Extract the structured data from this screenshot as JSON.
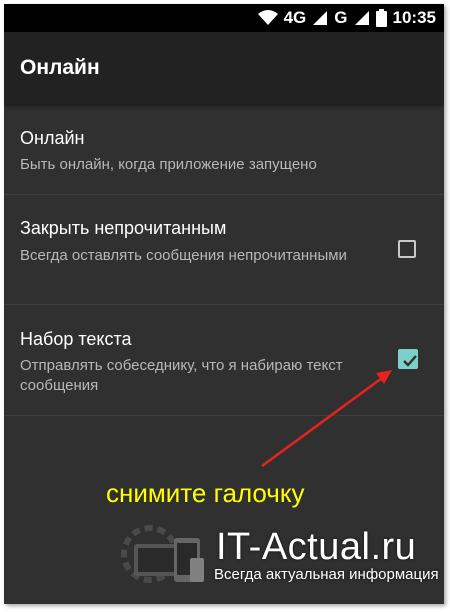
{
  "status_bar": {
    "network": "4G",
    "network2": "G",
    "time": "10:35",
    "icons": [
      "wifi-icon",
      "signal-icon",
      "signal-icon-2",
      "battery-icon"
    ]
  },
  "app_bar": {
    "title": "Онлайн"
  },
  "preferences": [
    {
      "title": "Онлайн",
      "summary": "Быть онлайн, когда приложение запущено"
    },
    {
      "title": "Закрыть непрочитанным",
      "summary": "Всегда оставлять сообщения непрочитанными",
      "checked": false
    },
    {
      "title": "Набор текста",
      "summary": "Отправлять собеседнику, что я набираю текст сообщения",
      "checked": true
    }
  ],
  "annotation": {
    "text": "снимите галочку",
    "color": "#ffff00",
    "arrow_color": "#e8231f"
  },
  "watermark": {
    "name": "IT-Actual.ru",
    "tagline": "Всегда актуальная информация"
  },
  "colors": {
    "background": "#303030",
    "app_bar": "#222222",
    "accent": "#7dcfc7"
  }
}
